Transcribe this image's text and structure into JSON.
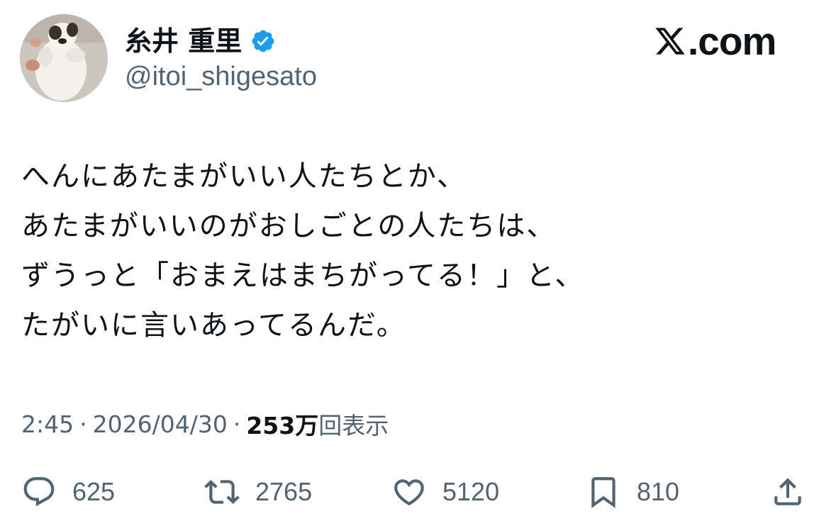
{
  "author": {
    "display_name": "糸井 重里",
    "handle": "@itoi_shigesato",
    "verified": true
  },
  "branding": {
    "site": ".com",
    "logo_icon": "x-logo-icon"
  },
  "tweet": {
    "lines": [
      "へんにあたまがいい人たちとか、",
      "あたまがいいのがおしごとの人たちは、",
      "ずうっと「おまえはまちがってる！」と、",
      "たがいに言いあってるんだ。"
    ]
  },
  "meta": {
    "time": "2:45",
    "separator": "·",
    "date": "2026/04/30",
    "views_count": "253万",
    "views_label": "回表示"
  },
  "actions": {
    "reply": {
      "icon": "reply-icon",
      "count": "625"
    },
    "retweet": {
      "icon": "retweet-icon",
      "count": "2765"
    },
    "like": {
      "icon": "heart-icon",
      "count": "5120"
    },
    "bookmark": {
      "icon": "bookmark-icon",
      "count": "810"
    },
    "share": {
      "icon": "share-icon"
    }
  },
  "colors": {
    "text_primary": "#0f1419",
    "text_secondary": "#536471",
    "verified_blue": "#1d9bf0",
    "background": "#ffffff"
  }
}
